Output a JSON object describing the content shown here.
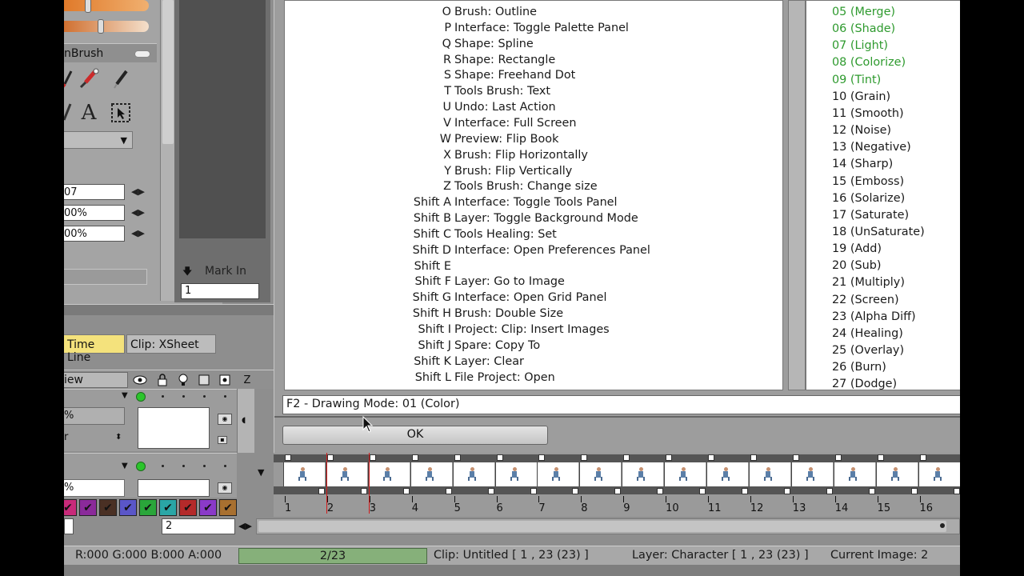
{
  "left_panel": {
    "brush_title": "nBrush",
    "num_fields": [
      "07",
      "00%",
      "00%"
    ]
  },
  "mark": {
    "label": "Mark In",
    "value": "1"
  },
  "tabs": {
    "timeline": "Time Line",
    "xsheet": "Clip: XSheet"
  },
  "layers": {
    "view_label": "iew",
    "layer1_field1": "%",
    "layer1_field2": "r",
    "layer2_field1": "%"
  },
  "frame_input": "2",
  "timeline": {
    "frames": [
      "1",
      "2",
      "3",
      "4",
      "5",
      "6",
      "7",
      "8",
      "9",
      "10",
      "11",
      "12",
      "13",
      "14",
      "15",
      "16"
    ]
  },
  "shortcuts": [
    {
      "key": "O",
      "desc": "Brush: Outline"
    },
    {
      "key": "P",
      "desc": "Interface: Toggle Palette Panel"
    },
    {
      "key": "Q",
      "desc": "Shape: Spline"
    },
    {
      "key": "R",
      "desc": "Shape: Rectangle"
    },
    {
      "key": "S",
      "desc": "Shape: Freehand Dot"
    },
    {
      "key": "T",
      "desc": "Tools Brush: Text"
    },
    {
      "key": "U",
      "desc": "Undo: Last Action"
    },
    {
      "key": "V",
      "desc": "Interface: Full Screen"
    },
    {
      "key": "W",
      "desc": "Preview: Flip Book"
    },
    {
      "key": "X",
      "desc": "Brush: Flip Horizontally"
    },
    {
      "key": "Y",
      "desc": "Brush: Flip Vertically"
    },
    {
      "key": "Z",
      "desc": "Tools Brush: Change size"
    },
    {
      "key": "Shift A",
      "desc": "Interface: Toggle Tools Panel"
    },
    {
      "key": "Shift B",
      "desc": "Layer: Toggle Background Mode"
    },
    {
      "key": "Shift C",
      "desc": "Tools Healing: Set"
    },
    {
      "key": "Shift D",
      "desc": "Interface: Open Preferences Panel"
    },
    {
      "key": "Shift E",
      "desc": ""
    },
    {
      "key": "Shift F",
      "desc": "Layer: Go to Image"
    },
    {
      "key": "Shift G",
      "desc": "Interface: Open Grid Panel"
    },
    {
      "key": "Shift H",
      "desc": "Brush: Double Size"
    },
    {
      "key": "Shift I",
      "desc": "Project: Clip: Insert Images"
    },
    {
      "key": "Shift J",
      "desc": "Spare: Copy To"
    },
    {
      "key": "Shift K",
      "desc": "Layer: Clear"
    },
    {
      "key": "Shift L",
      "desc": "File Project: Open"
    }
  ],
  "modes": [
    {
      "label": "05 (Merge)",
      "color": "#2e9a2e"
    },
    {
      "label": "06 (Shade)",
      "color": "#2e9a2e"
    },
    {
      "label": "07 (Light)",
      "color": "#2e9a2e"
    },
    {
      "label": "08 (Colorize)",
      "color": "#2e9a2e"
    },
    {
      "label": "09 (Tint)",
      "color": "#2e9a2e"
    },
    {
      "label": "10 (Grain)",
      "color": "#1a1a1a"
    },
    {
      "label": "11 (Smooth)",
      "color": "#1a1a1a"
    },
    {
      "label": "12 (Noise)",
      "color": "#1a1a1a"
    },
    {
      "label": "13 (Negative)",
      "color": "#1a1a1a"
    },
    {
      "label": "14 (Sharp)",
      "color": "#1a1a1a"
    },
    {
      "label": "15 (Emboss)",
      "color": "#1a1a1a"
    },
    {
      "label": "16 (Solarize)",
      "color": "#1a1a1a"
    },
    {
      "label": "17 (Saturate)",
      "color": "#1a1a1a"
    },
    {
      "label": "18 (UnSaturate)",
      "color": "#1a1a1a"
    },
    {
      "label": "19 (Add)",
      "color": "#1a1a1a"
    },
    {
      "label": "20 (Sub)",
      "color": "#1a1a1a"
    },
    {
      "label": "21 (Multiply)",
      "color": "#1a1a1a"
    },
    {
      "label": "22 (Screen)",
      "color": "#1a1a1a"
    },
    {
      "label": "23 (Alpha Diff)",
      "color": "#1a1a1a"
    },
    {
      "label": "24 (Healing)",
      "color": "#1a1a1a"
    },
    {
      "label": "25 (Overlay)",
      "color": "#1a1a1a"
    },
    {
      "label": "26 (Burn)",
      "color": "#1a1a1a"
    },
    {
      "label": "27 (Dodge)",
      "color": "#1a1a1a"
    }
  ],
  "dialog": {
    "status": "F2 - Drawing Mode: 01 (Color)",
    "ok_label": "OK"
  },
  "statusbar": {
    "rgba": "R:000 G:000 B:000 A:000",
    "progress": "2/23",
    "progress_fraction": 0.087,
    "clip": "Clip: Untitled [ 1 , 23  (23) ]",
    "layer": "Layer: Character [ 1 , 23  (23) ]",
    "image": "Current Image: 2"
  },
  "swatch_colors": [
    "#c82a7a",
    "#8a2a9a",
    "#4a3024",
    "#5a56c8",
    "#2aa63a",
    "#2aa6a6",
    "#b42a2a",
    "#8a3ac8",
    "#a87030"
  ],
  "icons": [
    "arrow-down-icon",
    "eye-icon",
    "lock-icon",
    "bulb-icon",
    "square-icon",
    "target-icon",
    "pencil-icon",
    "brush-icon",
    "text-icon",
    "select-icon",
    "check-icon"
  ]
}
